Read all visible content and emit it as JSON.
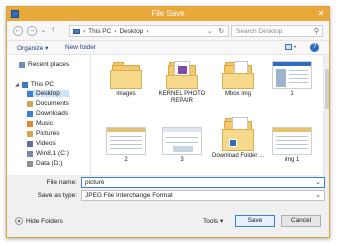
{
  "window": {
    "title": "File Save"
  },
  "address": {
    "back": "←",
    "forward": "→",
    "up": "↑",
    "path": [
      "This PC",
      "Desktop"
    ],
    "dropdown": "⌄",
    "refresh": "↻",
    "search_placeholder": "Search Desktop"
  },
  "toolbar": {
    "organize": "Organize ▾",
    "new_folder": "New folder",
    "help": "?"
  },
  "nav": {
    "items": [
      {
        "label": "Recent places"
      },
      {
        "label": "This PC"
      },
      {
        "label": "Desktop"
      },
      {
        "label": "Documents"
      },
      {
        "label": "Downloads"
      },
      {
        "label": "Music"
      },
      {
        "label": "Pictures"
      },
      {
        "label": "Videos"
      },
      {
        "label": "Win8.1 (C:)"
      },
      {
        "label": "Data (D:)"
      }
    ]
  },
  "files": [
    {
      "label": "images",
      "kind": "folder"
    },
    {
      "label": "KERNEL PHOTO REPAIR",
      "kind": "folder-doc"
    },
    {
      "label": "Mbox img",
      "kind": "folder"
    },
    {
      "label": "1",
      "kind": "image"
    },
    {
      "label": "2",
      "kind": "image"
    },
    {
      "label": "3",
      "kind": "image"
    },
    {
      "label": "Download Folder ...",
      "kind": "folder-shortcut"
    },
    {
      "label": "img 1",
      "kind": "image"
    }
  ],
  "save": {
    "file_name_label": "File name:",
    "file_name_value": "picture",
    "save_type_label": "Save as type:",
    "save_type_value": "JPEG File Interchange Format",
    "hide_folders": "Hide Folders",
    "tools": "Tools",
    "save_button": "Save",
    "cancel_button": "Cancel"
  },
  "colors": {
    "titlebar": "#e9a93a",
    "accent": "#3c7fd5",
    "folder": "#f4c86b"
  }
}
